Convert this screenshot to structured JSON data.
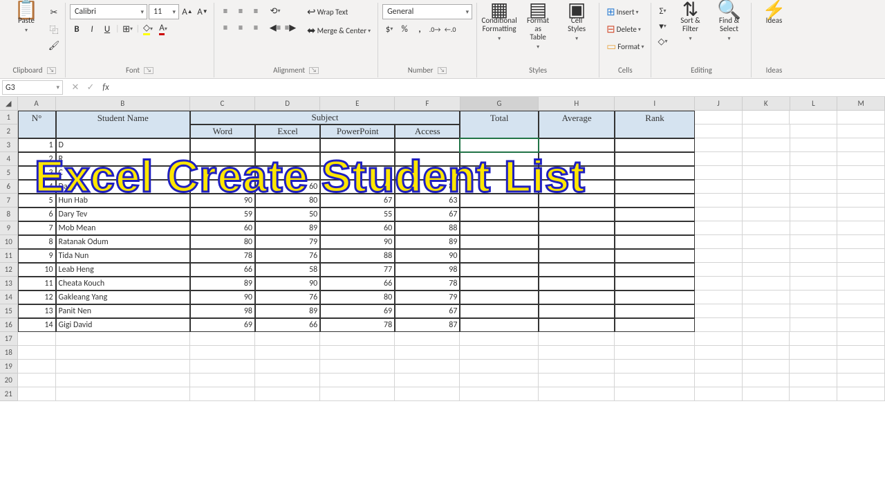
{
  "ribbon": {
    "clipboard": {
      "label": "Clipboard",
      "paste": "Paste"
    },
    "font": {
      "label": "Font",
      "name": "Calibri",
      "size": "11",
      "bold": "B",
      "italic": "I",
      "underline": "U"
    },
    "alignment": {
      "label": "Alignment",
      "wrap": "Wrap Text",
      "merge": "Merge & Center"
    },
    "number": {
      "label": "Number",
      "format": "General"
    },
    "styles": {
      "label": "Styles",
      "cond": "Conditional\nFormatting",
      "table": "Format as\nTable",
      "cell": "Cell\nStyles"
    },
    "cells": {
      "label": "Cells",
      "insert": "Insert",
      "delete": "Delete",
      "format": "Format"
    },
    "editing": {
      "label": "Editing",
      "sort": "Sort &\nFilter",
      "find": "Find &\nSelect"
    },
    "ideas": {
      "label": "Ideas",
      "btn": "Ideas"
    }
  },
  "formula": {
    "name": "G3",
    "fx": "fx"
  },
  "columns": [
    "A",
    "B",
    "C",
    "D",
    "E",
    "F",
    "G",
    "H",
    "I",
    "J",
    "K",
    "L",
    "M"
  ],
  "header": {
    "no": "N°",
    "student": "Student Name",
    "subject": "Subject",
    "word": "Word",
    "excel": "Excel",
    "ppt": "PowerPoint",
    "access": "Access",
    "total": "Total",
    "avg": "Average",
    "rank": "Rank"
  },
  "rows": [
    {
      "n": "1",
      "name": "D",
      "w": "",
      "e": "",
      "p": "",
      "a": ""
    },
    {
      "n": "2",
      "name": "R",
      "w": "",
      "e": "",
      "p": "",
      "a": ""
    },
    {
      "n": "3",
      "name": "C",
      "w": "",
      "e": "",
      "p": "",
      "a": ""
    },
    {
      "n": "4",
      "name": "Dane",
      "w": "65",
      "e": "60",
      "p": "70",
      "a": "85"
    },
    {
      "n": "5",
      "name": "Hun Hab",
      "w": "90",
      "e": "80",
      "p": "67",
      "a": "63"
    },
    {
      "n": "6",
      "name": "Dary Tev",
      "w": "59",
      "e": "50",
      "p": "55",
      "a": "67"
    },
    {
      "n": "7",
      "name": "Mob Mean",
      "w": "60",
      "e": "89",
      "p": "60",
      "a": "88"
    },
    {
      "n": "8",
      "name": "Ratanak Odum",
      "w": "80",
      "e": "79",
      "p": "90",
      "a": "89"
    },
    {
      "n": "9",
      "name": "Tida Nun",
      "w": "78",
      "e": "76",
      "p": "88",
      "a": "90"
    },
    {
      "n": "10",
      "name": "Leab Heng",
      "w": "66",
      "e": "58",
      "p": "77",
      "a": "98"
    },
    {
      "n": "11",
      "name": "Cheata Kouch",
      "w": "89",
      "e": "90",
      "p": "66",
      "a": "78"
    },
    {
      "n": "12",
      "name": "Gakleang Yang",
      "w": "90",
      "e": "76",
      "p": "80",
      "a": "79"
    },
    {
      "n": "13",
      "name": "Panit Nen",
      "w": "98",
      "e": "89",
      "p": "69",
      "a": "67"
    },
    {
      "n": "14",
      "name": "Gigi David",
      "w": "69",
      "e": "66",
      "p": "78",
      "a": "87"
    }
  ],
  "overlay": "Excel Create Student List"
}
